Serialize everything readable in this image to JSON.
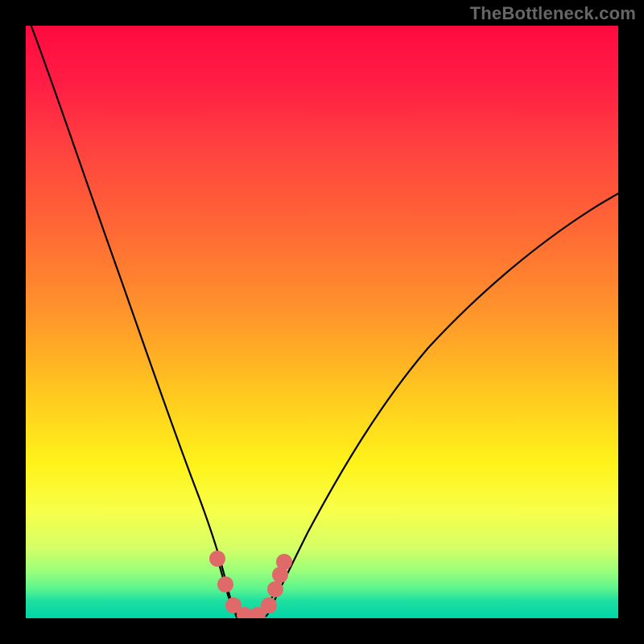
{
  "watermark": "TheBottleneck.com",
  "colors": {
    "background": "#000000",
    "curve": "#000000",
    "well": "#e06a6a"
  },
  "chart_data": {
    "type": "line",
    "title": "",
    "xlabel": "",
    "ylabel": "",
    "xlim": [
      0,
      100
    ],
    "ylim": [
      0,
      100
    ],
    "grid": false,
    "legend": false,
    "series": [
      {
        "name": "bottleneck-curve",
        "x": [
          0,
          5,
          10,
          15,
          20,
          25,
          28,
          30,
          32,
          34,
          36,
          38,
          40,
          45,
          50,
          55,
          60,
          65,
          70,
          75,
          80,
          85,
          90,
          95,
          100
        ],
        "y": [
          100,
          84,
          68,
          53,
          38,
          24,
          16,
          11,
          7,
          4,
          2,
          3,
          6,
          14,
          23,
          32,
          40,
          47,
          53,
          59,
          64,
          69,
          73,
          77,
          80
        ]
      }
    ],
    "well_region": {
      "x_range": [
        30,
        40
      ],
      "points": [
        {
          "x": 30,
          "y": 11
        },
        {
          "x": 32,
          "y": 7
        },
        {
          "x": 33,
          "y": 4
        },
        {
          "x": 34,
          "y": 2
        },
        {
          "x": 36,
          "y": 2
        },
        {
          "x": 38,
          "y": 3
        },
        {
          "x": 39,
          "y": 6
        },
        {
          "x": 40,
          "y": 9
        },
        {
          "x": 41,
          "y": 12
        }
      ]
    }
  }
}
